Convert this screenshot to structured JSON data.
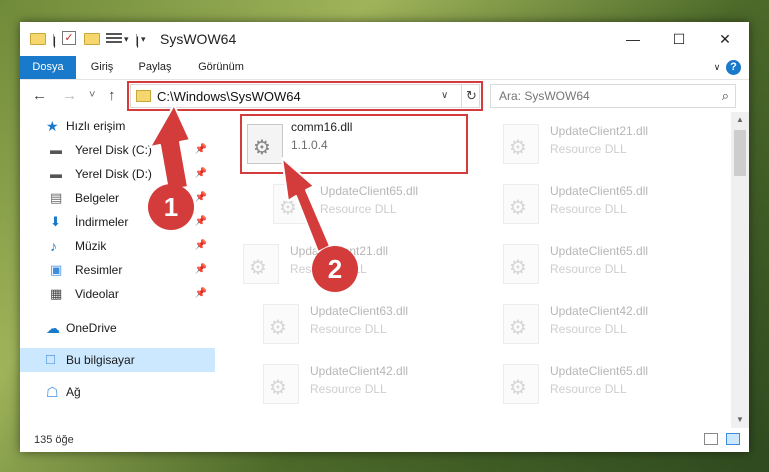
{
  "window": {
    "title": "SysWOW64"
  },
  "quick_access_toolbar": {
    "dropdown_glyph": "▾",
    "separator_glyph": "|"
  },
  "window_controls": {
    "minimize": "—",
    "maximize": "☐",
    "close": "✕"
  },
  "ribbon": {
    "tabs": [
      {
        "label": "Dosya",
        "active": true
      },
      {
        "label": "Giriş"
      },
      {
        "label": "Paylaş"
      },
      {
        "label": "Görünüm"
      }
    ],
    "help": "?"
  },
  "nav": {
    "back": "←",
    "forward": "→",
    "recent": "˅",
    "up": "↑",
    "address": "C:\\Windows\\SysWOW64",
    "address_dropdown": "∨",
    "refresh": "↻",
    "search_placeholder": "Ara: SysWOW64",
    "search_glyph": "⌕"
  },
  "sidebar": {
    "pin_glyph": "📌",
    "items": [
      {
        "label": "Hızlı erişim",
        "icon": "star-icon",
        "glyph": "★",
        "color": "#1979ca"
      },
      {
        "label": "Yerel Disk (C:)",
        "icon": "drive-icon",
        "glyph": "▬",
        "pinned": true
      },
      {
        "label": "Yerel Disk (D:)",
        "icon": "drive-icon",
        "glyph": "▬",
        "pinned": true
      },
      {
        "label": "Belgeler",
        "icon": "documents-icon",
        "glyph": "▤",
        "pinned": true
      },
      {
        "label": "İndirmeler",
        "icon": "download-icon",
        "glyph": "⬇",
        "pinned": true
      },
      {
        "label": "Müzik",
        "icon": "music-icon",
        "glyph": "♪",
        "pinned": true
      },
      {
        "label": "Resimler",
        "icon": "pictures-icon",
        "glyph": "▣",
        "pinned": true
      },
      {
        "label": "Videolar",
        "icon": "video-icon",
        "glyph": "▦",
        "pinned": true
      },
      {
        "label": "OneDrive",
        "icon": "cloud-icon",
        "glyph": "☁",
        "color": "#1979ca"
      },
      {
        "label": "Bu bilgisayar",
        "icon": "computer-icon",
        "glyph": "□",
        "selected": true
      },
      {
        "label": "Ağ",
        "icon": "network-icon",
        "glyph": "☖"
      }
    ]
  },
  "files": {
    "gear_glyph": "⚙",
    "items": [
      {
        "name": "comm16.dll",
        "desc": "1.1.0.4",
        "highlighted": true
      },
      {
        "name": "UpdateClient21.dll",
        "desc": "Resource DLL"
      },
      {
        "name": "UpdateClient65.dll",
        "desc": "Resource DLL"
      },
      {
        "name": "UpdateClient65.dll",
        "desc": "Resource DLL"
      },
      {
        "name": "UpdateClient21.dll",
        "desc": "Resource DLL"
      },
      {
        "name": "UpdateClient65.dll",
        "desc": "Resource DLL"
      },
      {
        "name": "UpdateClient63.dll",
        "desc": "Resource DLL"
      },
      {
        "name": "UpdateClient42.dll",
        "desc": "Resource DLL"
      },
      {
        "name": "UpdateClient42.dll",
        "desc": "Resource DLL"
      },
      {
        "name": "UpdateClient65.dll",
        "desc": "Resource DLL"
      }
    ]
  },
  "scrollbar": {
    "up": "▲",
    "down": "▼"
  },
  "status": {
    "count": "135 öğe"
  },
  "callouts": {
    "one": "1",
    "two": "2"
  },
  "colors": {
    "accent": "#1979ca",
    "highlight": "#d43c3c",
    "selected": "#cce8ff"
  }
}
